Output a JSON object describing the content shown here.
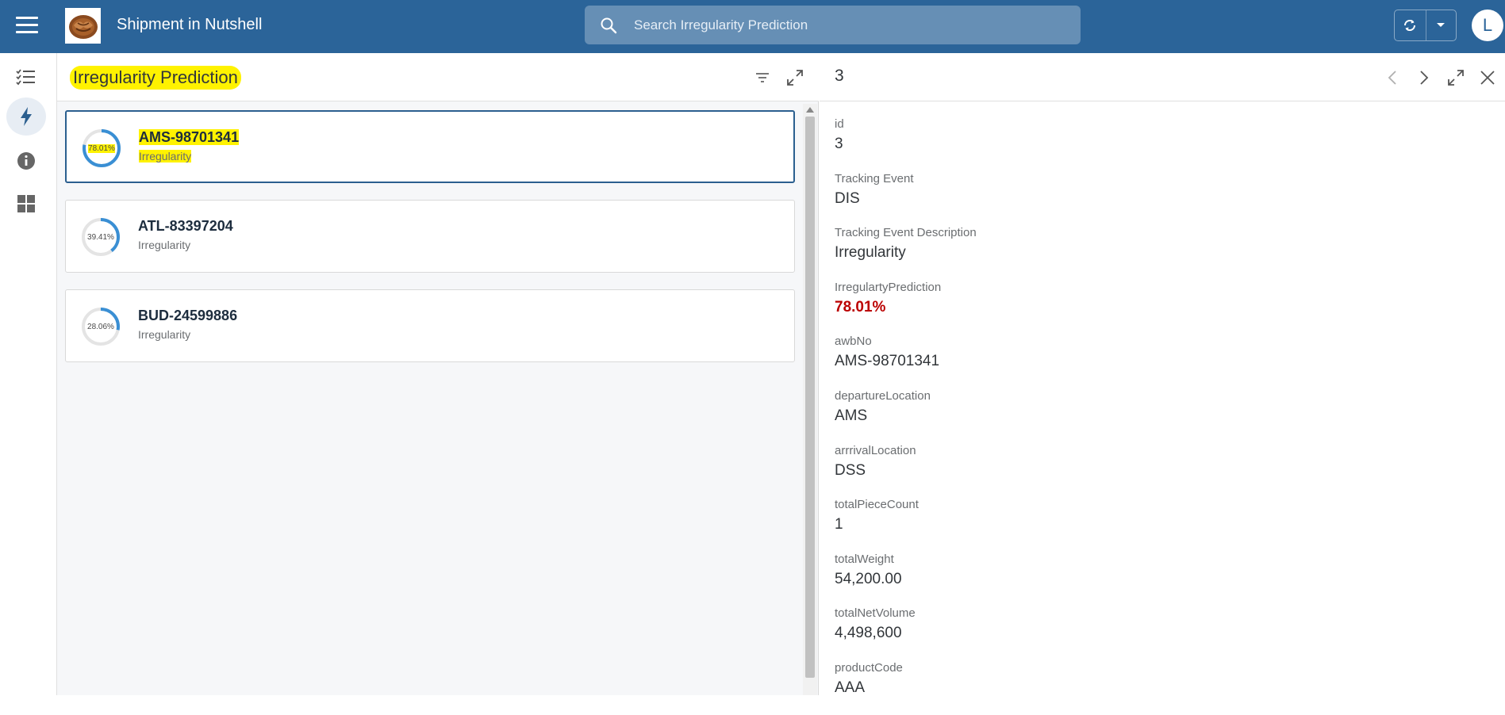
{
  "shell": {
    "title": "Shipment in Nutshell",
    "search_placeholder": "Search Irregularity Prediction",
    "avatar_initial": "L",
    "brand_color": "#2b6499"
  },
  "sidenav": {
    "items": [
      {
        "icon": "task-list-icon"
      },
      {
        "icon": "lightning-icon",
        "active": true
      },
      {
        "icon": "info-icon"
      },
      {
        "icon": "dashboard-icon"
      }
    ]
  },
  "master": {
    "title": "Irregularity Prediction",
    "items": [
      {
        "awb": "AMS-98701341",
        "subtitle": "Irregularity",
        "percent_label": "78.01%",
        "fraction": 0.7801,
        "selected": true
      },
      {
        "awb": "ATL-83397204",
        "subtitle": "Irregularity",
        "percent_label": "39.41%",
        "fraction": 0.3941,
        "selected": false
      },
      {
        "awb": "BUD-24599886",
        "subtitle": "Irregularity",
        "percent_label": "28.06%",
        "fraction": 0.2806,
        "selected": false
      }
    ]
  },
  "detail": {
    "title": "3",
    "fields": [
      {
        "label": "id",
        "value": "3"
      },
      {
        "label": "Tracking Event",
        "value": "DIS"
      },
      {
        "label": "Tracking Event Description",
        "value": "Irregularity"
      },
      {
        "label": "IrregulartyPrediction",
        "value": "78.01%",
        "alert": true
      },
      {
        "label": "awbNo",
        "value": "AMS-98701341"
      },
      {
        "label": "departureLocation",
        "value": "AMS"
      },
      {
        "label": "arrrivalLocation",
        "value": "DSS"
      },
      {
        "label": "totalPieceCount",
        "value": "1"
      },
      {
        "label": "totalWeight",
        "value": "54,200.00"
      },
      {
        "label": "totalNetVolume",
        "value": "4,498,600"
      },
      {
        "label": "productCode",
        "value": "AAA"
      }
    ],
    "alert_color": "#bb0000"
  }
}
